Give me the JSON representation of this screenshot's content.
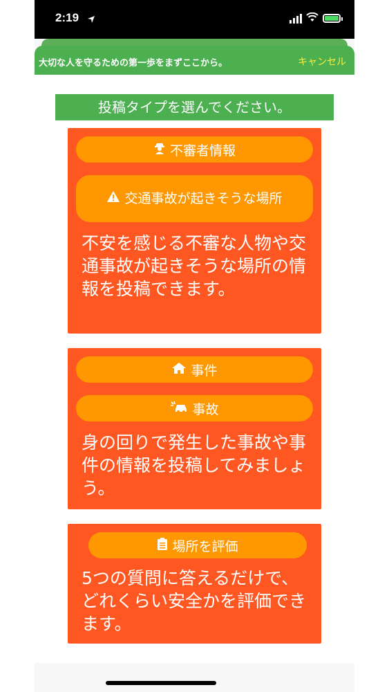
{
  "status": {
    "time": "2:19"
  },
  "header": {
    "title": "大切な人を守るための第一歩をまずここから。",
    "cancel": "キャンセル"
  },
  "main": {
    "title": "投稿タイプを選んでください。",
    "cards": [
      {
        "buttons": [
          {
            "label": "不審者情報",
            "icon": "suspicious-person-icon"
          },
          {
            "label": "交通事故が起きそうな場所",
            "icon": "warning-icon"
          }
        ],
        "description": "不安を感じる不審な人物や交通事故が起きそうな場所の情報を投稿できます。"
      },
      {
        "buttons": [
          {
            "label": "事件",
            "icon": "home-icon"
          },
          {
            "label": "事故",
            "icon": "car-crash-icon"
          }
        ],
        "description": "身の回りで発生した事故や事件の情報を投稿してみましょう。"
      },
      {
        "buttons": [
          {
            "label": "場所を評価",
            "icon": "clipboard-icon"
          }
        ],
        "description": "5つの質問に答えるだけで、どれくらい安全かを評価できます。"
      }
    ]
  },
  "colors": {
    "header": "#4caf50",
    "card": "#ff5722",
    "button": "#ff9800",
    "cancel": "#ffeb3b"
  }
}
